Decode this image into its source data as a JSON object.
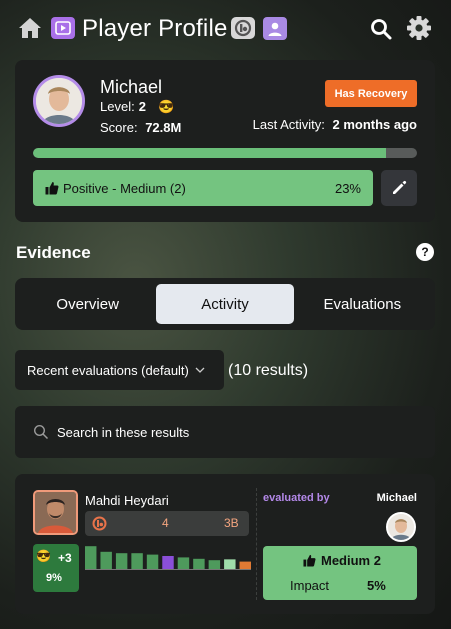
{
  "header": {
    "title": "Player Profile",
    "icons": [
      "home-icon",
      "media-icon",
      "badge-icon",
      "user-icon",
      "search-icon",
      "gear-icon"
    ]
  },
  "profile": {
    "name": "Michael",
    "level_label": "Level:",
    "level_value": "2",
    "level_emoji": "😎",
    "score_label": "Score:",
    "score_value": "72.8M",
    "recovery_badge": "Has Recovery",
    "last_activity_label": "Last Activity:",
    "last_activity_value": "2 months ago",
    "progress_percent": 92,
    "rating_label": "Positive - Medium (2)",
    "rating_percent": "23%"
  },
  "evidence": {
    "title": "Evidence",
    "tabs": [
      {
        "label": "Overview",
        "active": false
      },
      {
        "label": "Activity",
        "active": true
      },
      {
        "label": "Evaluations",
        "active": false
      }
    ],
    "sort_label": "Recent evaluations (default)",
    "results_count": "(10 results)",
    "search_placeholder": "Search in these results"
  },
  "evaluation": {
    "evaluator_display_name": "Mahdi Heydari",
    "stat_a": "4",
    "stat_b": "3B",
    "emoji": "😎",
    "delta": "+3",
    "delta_percent": "9%",
    "evaluated_by_label": "evaluated by",
    "evaluated_player": "Michael",
    "impact_rating": "Medium 2",
    "impact_label": "Impact",
    "impact_value": "5%",
    "mini_bars": [
      {
        "level": 0.85,
        "color": "#4e9a5c"
      },
      {
        "level": 0.65,
        "color": "#4e9a5c"
      },
      {
        "level": 0.6,
        "color": "#4e9a5c"
      },
      {
        "level": 0.6,
        "color": "#4e9a5c"
      },
      {
        "level": 0.55,
        "color": "#4e9a5c"
      },
      {
        "level": 0.5,
        "color": "#8a4fd8"
      },
      {
        "level": 0.45,
        "color": "#4e9a5c"
      },
      {
        "level": 0.4,
        "color": "#4e9a5c"
      },
      {
        "level": 0.35,
        "color": "#4e9a5c"
      },
      {
        "level": 0.38,
        "color": "#9fdcaa"
      },
      {
        "level": 0.3,
        "color": "#e07a33"
      }
    ]
  },
  "colors": {
    "accent_green": "#74c480",
    "recovery_orange": "#ee6d28",
    "purple": "#a970e8"
  }
}
